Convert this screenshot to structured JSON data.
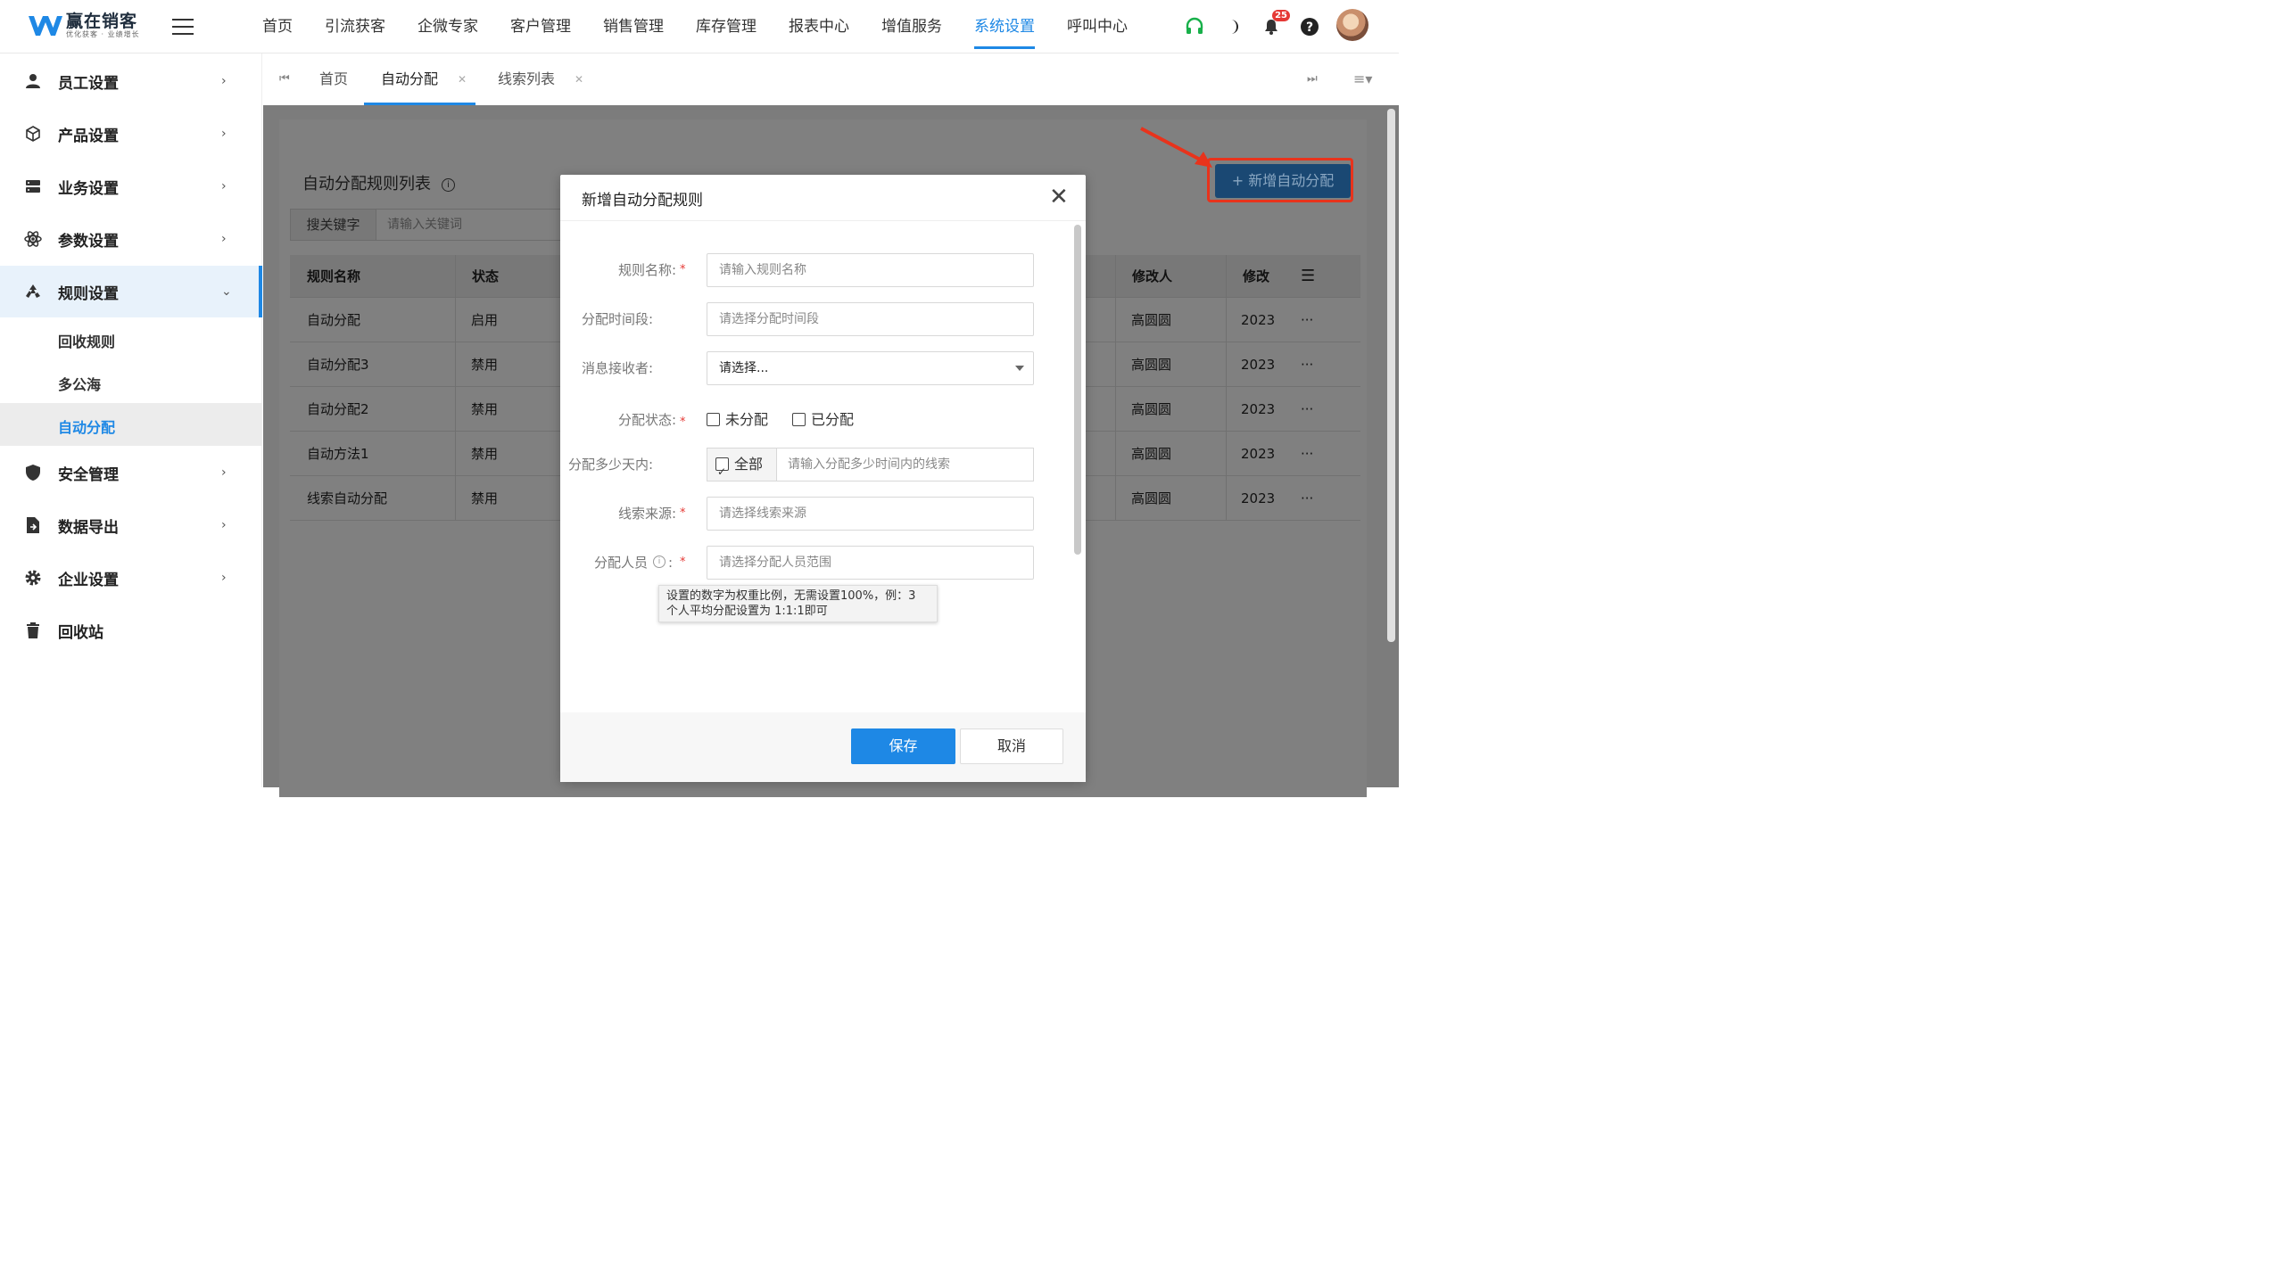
{
  "app": {
    "logo_title": "赢在销客",
    "logo_sub": "优化获客 · 业绩增长",
    "brand_color": "#1e88e5"
  },
  "topnav": {
    "items": [
      "首页",
      "引流获客",
      "企微专家",
      "客户管理",
      "销售管理",
      "库存管理",
      "报表中心",
      "增值服务",
      "系统设置",
      "呼叫中心"
    ],
    "active": "系统设置",
    "notification_count": "25"
  },
  "sidebar": {
    "items": [
      {
        "label": "员工设置",
        "icon": "user-icon"
      },
      {
        "label": "产品设置",
        "icon": "cube-icon"
      },
      {
        "label": "业务设置",
        "icon": "server-icon"
      },
      {
        "label": "参数设置",
        "icon": "atom-icon"
      },
      {
        "label": "规则设置",
        "icon": "recycle-icon"
      },
      {
        "label": "安全管理",
        "icon": "shield-icon"
      },
      {
        "label": "数据导出",
        "icon": "file-export-icon"
      },
      {
        "label": "企业设置",
        "icon": "gear-icon"
      },
      {
        "label": "回收站",
        "icon": "trash-icon"
      }
    ],
    "sub_items": [
      "回收规则",
      "多公海",
      "自动分配"
    ],
    "active_sub": "自动分配"
  },
  "tabs": {
    "items": [
      {
        "label": "首页",
        "closable": false
      },
      {
        "label": "自动分配",
        "closable": true
      },
      {
        "label": "线索列表",
        "closable": true
      }
    ],
    "active": "自动分配"
  },
  "list": {
    "title": "自动分配规则列表",
    "search_label": "搜关键字",
    "search_placeholder": "请输入关键词",
    "add_button": "+ 新增自动分配",
    "columns": {
      "name": "规则名称",
      "status": "状态",
      "modifier": "修改人",
      "modified": "修改"
    },
    "rows": [
      {
        "name": "自动分配",
        "status": "启用",
        "modifier": "高圆圆",
        "modified": "2023"
      },
      {
        "name": "自动分配3",
        "status": "禁用",
        "modifier": "高圆圆",
        "modified": "2023"
      },
      {
        "name": "自动分配2",
        "status": "禁用",
        "modifier": "高圆圆",
        "modified": "2023"
      },
      {
        "name": "自动方法1",
        "status": "禁用",
        "modifier": "高圆圆",
        "modified": "2023"
      },
      {
        "name": "线索自动分配",
        "status": "禁用",
        "modifier": "高圆圆",
        "modified": "2023"
      }
    ],
    "row_action": "···"
  },
  "modal": {
    "title": "新增自动分配规则",
    "fields": {
      "rule_name": {
        "label": "规则名称:",
        "placeholder": "请输入规则名称"
      },
      "time_range": {
        "label": "分配时间段:",
        "placeholder": "请选择分配时间段"
      },
      "receiver": {
        "label": "消息接收者:",
        "value": "请选择..."
      },
      "status": {
        "label": "分配状态:",
        "options": [
          "未分配",
          "已分配"
        ]
      },
      "days": {
        "label": "分配多少天内:",
        "all_label": "全部",
        "placeholder": "请输入分配多少时间内的线索"
      },
      "source": {
        "label": "线索来源:",
        "placeholder": "请选择线索来源"
      },
      "staff": {
        "label": "分配人员",
        "placeholder": "请选择分配人员范围"
      }
    },
    "tooltip_line1": "设置的数字为权重比例，无需设置100%，例：3",
    "tooltip_line2": "个人平均分配设置为 1:1:1即可",
    "save": "保存",
    "cancel": "取消"
  }
}
